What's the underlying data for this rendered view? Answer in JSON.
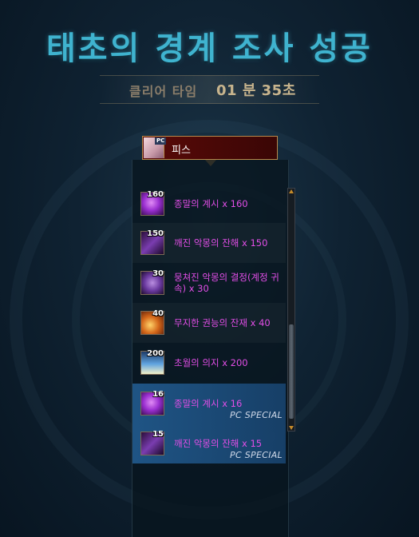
{
  "title": "태초의 경계 조사 성공",
  "clear_time": {
    "label": "클리어 타임",
    "value": "01 분 35초"
  },
  "player": {
    "pc_badge": "PC",
    "name": "피스"
  },
  "items": [
    {
      "qty": "160",
      "name": "종말의 계시 x 160",
      "icon": "purple-orb-icon",
      "icon_color": "#9a2fd0"
    },
    {
      "qty": "150",
      "name": "깨진 악몽의 잔해 x 150",
      "icon": "nightmare-shard-icon",
      "icon_color": "#5a2a8a"
    },
    {
      "qty": "30",
      "name": "뭉쳐진 악몽의 결정(계정 귀속) x 30",
      "icon": "nightmare-crystal-icon",
      "icon_color": "#6b3aa0"
    },
    {
      "qty": "40",
      "name": "무지한 권능의 잔재 x 40",
      "icon": "fire-swirl-icon",
      "icon_color": "#d4671a"
    },
    {
      "qty": "200",
      "name": "초월의 의지 x 200",
      "icon": "wings-icon",
      "icon_color": "#5fa3e0"
    },
    {
      "qty": "16",
      "name": "종말의 계시 x 16",
      "icon": "purple-orb-icon",
      "icon_color": "#9a2fd0",
      "tag": "PC SPECIAL"
    },
    {
      "qty": "15",
      "name": "깨진 악몽의 잔해 x 15",
      "icon": "nightmare-shard-icon",
      "icon_color": "#5a2a8a",
      "tag": "PC SPECIAL"
    }
  ],
  "colors": {
    "title": "#3fb3cf",
    "item_text": "#e24ee7",
    "special_row": "#235f96"
  }
}
